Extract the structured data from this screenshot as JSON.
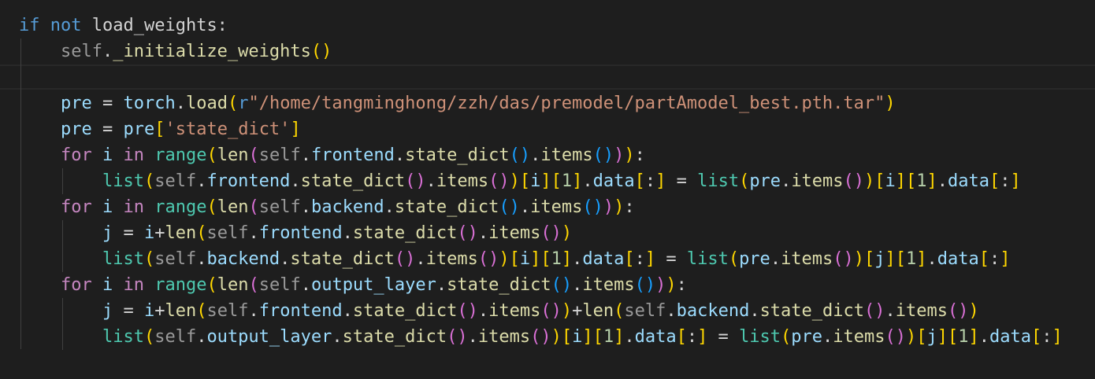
{
  "code": {
    "lines": [
      {
        "segments": [
          {
            "t": "if",
            "c": "kw"
          },
          {
            "t": " "
          },
          {
            "t": "not",
            "c": "kw"
          },
          {
            "t": " load_weights:"
          }
        ]
      },
      {
        "segments": [
          {
            "t": "    "
          },
          {
            "t": "self",
            "c": "slf"
          },
          {
            "t": "."
          },
          {
            "t": "_initialize_weights",
            "c": "fn"
          },
          {
            "t": "()",
            "c": "b1"
          }
        ]
      },
      {
        "segments": []
      },
      {
        "segments": [
          {
            "t": "    "
          },
          {
            "t": "pre",
            "c": "var"
          },
          {
            "t": " = "
          },
          {
            "t": "torch",
            "c": "var"
          },
          {
            "t": "."
          },
          {
            "t": "load",
            "c": "fn"
          },
          {
            "t": "(",
            "c": "b1"
          },
          {
            "t": "r",
            "c": "kw"
          },
          {
            "t": "\"/home/tangminghong/zzh/das/premodel/partAmodel_best.pth.tar\"",
            "c": "str"
          },
          {
            "t": ")",
            "c": "b1"
          }
        ]
      },
      {
        "segments": [
          {
            "t": "    "
          },
          {
            "t": "pre",
            "c": "var"
          },
          {
            "t": " = "
          },
          {
            "t": "pre",
            "c": "var"
          },
          {
            "t": "[",
            "c": "b1"
          },
          {
            "t": "'state_dict'",
            "c": "str"
          },
          {
            "t": "]",
            "c": "b1"
          }
        ]
      },
      {
        "segments": [
          {
            "t": "    "
          },
          {
            "t": "for",
            "c": "kc"
          },
          {
            "t": " "
          },
          {
            "t": "i",
            "c": "var"
          },
          {
            "t": " "
          },
          {
            "t": "in",
            "c": "kc"
          },
          {
            "t": " "
          },
          {
            "t": "range",
            "c": "fnb"
          },
          {
            "t": "(",
            "c": "b1"
          },
          {
            "t": "len",
            "c": "fn"
          },
          {
            "t": "(",
            "c": "b2"
          },
          {
            "t": "self",
            "c": "slf"
          },
          {
            "t": "."
          },
          {
            "t": "frontend",
            "c": "var"
          },
          {
            "t": "."
          },
          {
            "t": "state_dict",
            "c": "fn"
          },
          {
            "t": "()",
            "c": "b3"
          },
          {
            "t": "."
          },
          {
            "t": "items",
            "c": "fn"
          },
          {
            "t": "()",
            "c": "b3"
          },
          {
            "t": ")",
            "c": "b2"
          },
          {
            "t": ")",
            "c": "b1"
          },
          {
            "t": ":"
          }
        ]
      },
      {
        "segments": [
          {
            "t": "        "
          },
          {
            "t": "list",
            "c": "fnb"
          },
          {
            "t": "(",
            "c": "b1"
          },
          {
            "t": "self",
            "c": "slf"
          },
          {
            "t": "."
          },
          {
            "t": "frontend",
            "c": "var"
          },
          {
            "t": "."
          },
          {
            "t": "state_dict",
            "c": "fn"
          },
          {
            "t": "()",
            "c": "b2"
          },
          {
            "t": "."
          },
          {
            "t": "items",
            "c": "fn"
          },
          {
            "t": "()",
            "c": "b2"
          },
          {
            "t": ")",
            "c": "b1"
          },
          {
            "t": "[",
            "c": "b1"
          },
          {
            "t": "i",
            "c": "var"
          },
          {
            "t": "]",
            "c": "b1"
          },
          {
            "t": "[",
            "c": "b1"
          },
          {
            "t": "1",
            "c": "num"
          },
          {
            "t": "]",
            "c": "b1"
          },
          {
            "t": "."
          },
          {
            "t": "data",
            "c": "var"
          },
          {
            "t": "[",
            "c": "b1"
          },
          {
            "t": ":"
          },
          {
            "t": "]",
            "c": "b1"
          },
          {
            "t": " = "
          },
          {
            "t": "list",
            "c": "fnb"
          },
          {
            "t": "(",
            "c": "b1"
          },
          {
            "t": "pre",
            "c": "var"
          },
          {
            "t": "."
          },
          {
            "t": "items",
            "c": "fn"
          },
          {
            "t": "()",
            "c": "b2"
          },
          {
            "t": ")",
            "c": "b1"
          },
          {
            "t": "[",
            "c": "b1"
          },
          {
            "t": "i",
            "c": "var"
          },
          {
            "t": "]",
            "c": "b1"
          },
          {
            "t": "[",
            "c": "b1"
          },
          {
            "t": "1",
            "c": "num"
          },
          {
            "t": "]",
            "c": "b1"
          },
          {
            "t": "."
          },
          {
            "t": "data",
            "c": "var"
          },
          {
            "t": "[",
            "c": "b1"
          },
          {
            "t": ":"
          },
          {
            "t": "]",
            "c": "b1"
          }
        ]
      },
      {
        "segments": [
          {
            "t": "    "
          },
          {
            "t": "for",
            "c": "kc"
          },
          {
            "t": " "
          },
          {
            "t": "i",
            "c": "var"
          },
          {
            "t": " "
          },
          {
            "t": "in",
            "c": "kc"
          },
          {
            "t": " "
          },
          {
            "t": "range",
            "c": "fnb"
          },
          {
            "t": "(",
            "c": "b1"
          },
          {
            "t": "len",
            "c": "fn"
          },
          {
            "t": "(",
            "c": "b2"
          },
          {
            "t": "self",
            "c": "slf"
          },
          {
            "t": "."
          },
          {
            "t": "backend",
            "c": "var"
          },
          {
            "t": "."
          },
          {
            "t": "state_dict",
            "c": "fn"
          },
          {
            "t": "()",
            "c": "b3"
          },
          {
            "t": "."
          },
          {
            "t": "items",
            "c": "fn"
          },
          {
            "t": "()",
            "c": "b3"
          },
          {
            "t": ")",
            "c": "b2"
          },
          {
            "t": ")",
            "c": "b1"
          },
          {
            "t": ":"
          }
        ]
      },
      {
        "segments": [
          {
            "t": "        "
          },
          {
            "t": "j",
            "c": "var"
          },
          {
            "t": " = "
          },
          {
            "t": "i",
            "c": "var"
          },
          {
            "t": "+"
          },
          {
            "t": "len",
            "c": "fn"
          },
          {
            "t": "(",
            "c": "b1"
          },
          {
            "t": "self",
            "c": "slf"
          },
          {
            "t": "."
          },
          {
            "t": "frontend",
            "c": "var"
          },
          {
            "t": "."
          },
          {
            "t": "state_dict",
            "c": "fn"
          },
          {
            "t": "()",
            "c": "b2"
          },
          {
            "t": "."
          },
          {
            "t": "items",
            "c": "fn"
          },
          {
            "t": "()",
            "c": "b2"
          },
          {
            "t": ")",
            "c": "b1"
          }
        ]
      },
      {
        "segments": [
          {
            "t": "        "
          },
          {
            "t": "list",
            "c": "fnb"
          },
          {
            "t": "(",
            "c": "b1"
          },
          {
            "t": "self",
            "c": "slf"
          },
          {
            "t": "."
          },
          {
            "t": "backend",
            "c": "var"
          },
          {
            "t": "."
          },
          {
            "t": "state_dict",
            "c": "fn"
          },
          {
            "t": "()",
            "c": "b2"
          },
          {
            "t": "."
          },
          {
            "t": "items",
            "c": "fn"
          },
          {
            "t": "()",
            "c": "b2"
          },
          {
            "t": ")",
            "c": "b1"
          },
          {
            "t": "[",
            "c": "b1"
          },
          {
            "t": "i",
            "c": "var"
          },
          {
            "t": "]",
            "c": "b1"
          },
          {
            "t": "[",
            "c": "b1"
          },
          {
            "t": "1",
            "c": "num"
          },
          {
            "t": "]",
            "c": "b1"
          },
          {
            "t": "."
          },
          {
            "t": "data",
            "c": "var"
          },
          {
            "t": "[",
            "c": "b1"
          },
          {
            "t": ":"
          },
          {
            "t": "]",
            "c": "b1"
          },
          {
            "t": " = "
          },
          {
            "t": "list",
            "c": "fnb"
          },
          {
            "t": "(",
            "c": "b1"
          },
          {
            "t": "pre",
            "c": "var"
          },
          {
            "t": "."
          },
          {
            "t": "items",
            "c": "fn"
          },
          {
            "t": "()",
            "c": "b2"
          },
          {
            "t": ")",
            "c": "b1"
          },
          {
            "t": "[",
            "c": "b1"
          },
          {
            "t": "j",
            "c": "var"
          },
          {
            "t": "]",
            "c": "b1"
          },
          {
            "t": "[",
            "c": "b1"
          },
          {
            "t": "1",
            "c": "num"
          },
          {
            "t": "]",
            "c": "b1"
          },
          {
            "t": "."
          },
          {
            "t": "data",
            "c": "var"
          },
          {
            "t": "[",
            "c": "b1"
          },
          {
            "t": ":"
          },
          {
            "t": "]",
            "c": "b1"
          }
        ]
      },
      {
        "segments": [
          {
            "t": "    "
          },
          {
            "t": "for",
            "c": "kc"
          },
          {
            "t": " "
          },
          {
            "t": "i",
            "c": "var"
          },
          {
            "t": " "
          },
          {
            "t": "in",
            "c": "kc"
          },
          {
            "t": " "
          },
          {
            "t": "range",
            "c": "fnb"
          },
          {
            "t": "(",
            "c": "b1"
          },
          {
            "t": "len",
            "c": "fn"
          },
          {
            "t": "(",
            "c": "b2"
          },
          {
            "t": "self",
            "c": "slf"
          },
          {
            "t": "."
          },
          {
            "t": "output_layer",
            "c": "var"
          },
          {
            "t": "."
          },
          {
            "t": "state_dict",
            "c": "fn"
          },
          {
            "t": "()",
            "c": "b3"
          },
          {
            "t": "."
          },
          {
            "t": "items",
            "c": "fn"
          },
          {
            "t": "()",
            "c": "b3"
          },
          {
            "t": ")",
            "c": "b2"
          },
          {
            "t": ")",
            "c": "b1"
          },
          {
            "t": ":"
          }
        ]
      },
      {
        "segments": [
          {
            "t": "        "
          },
          {
            "t": "j",
            "c": "var"
          },
          {
            "t": " = "
          },
          {
            "t": "i",
            "c": "var"
          },
          {
            "t": "+"
          },
          {
            "t": "len",
            "c": "fn"
          },
          {
            "t": "(",
            "c": "b1"
          },
          {
            "t": "self",
            "c": "slf"
          },
          {
            "t": "."
          },
          {
            "t": "frontend",
            "c": "var"
          },
          {
            "t": "."
          },
          {
            "t": "state_dict",
            "c": "fn"
          },
          {
            "t": "()",
            "c": "b2"
          },
          {
            "t": "."
          },
          {
            "t": "items",
            "c": "fn"
          },
          {
            "t": "()",
            "c": "b2"
          },
          {
            "t": ")",
            "c": "b1"
          },
          {
            "t": "+"
          },
          {
            "t": "len",
            "c": "fn"
          },
          {
            "t": "(",
            "c": "b1"
          },
          {
            "t": "self",
            "c": "slf"
          },
          {
            "t": "."
          },
          {
            "t": "backend",
            "c": "var"
          },
          {
            "t": "."
          },
          {
            "t": "state_dict",
            "c": "fn"
          },
          {
            "t": "()",
            "c": "b2"
          },
          {
            "t": "."
          },
          {
            "t": "items",
            "c": "fn"
          },
          {
            "t": "()",
            "c": "b2"
          },
          {
            "t": ")",
            "c": "b1"
          }
        ]
      },
      {
        "segments": [
          {
            "t": "        "
          },
          {
            "t": "list",
            "c": "fnb"
          },
          {
            "t": "(",
            "c": "b1"
          },
          {
            "t": "self",
            "c": "slf"
          },
          {
            "t": "."
          },
          {
            "t": "output_layer",
            "c": "var"
          },
          {
            "t": "."
          },
          {
            "t": "state_dict",
            "c": "fn"
          },
          {
            "t": "()",
            "c": "b2"
          },
          {
            "t": "."
          },
          {
            "t": "items",
            "c": "fn"
          },
          {
            "t": "()",
            "c": "b2"
          },
          {
            "t": ")",
            "c": "b1"
          },
          {
            "t": "[",
            "c": "b1"
          },
          {
            "t": "i",
            "c": "var"
          },
          {
            "t": "]",
            "c": "b1"
          },
          {
            "t": "[",
            "c": "b1"
          },
          {
            "t": "1",
            "c": "num"
          },
          {
            "t": "]",
            "c": "b1"
          },
          {
            "t": "."
          },
          {
            "t": "data",
            "c": "var"
          },
          {
            "t": "[",
            "c": "b1"
          },
          {
            "t": ":"
          },
          {
            "t": "]",
            "c": "b1"
          },
          {
            "t": " = "
          },
          {
            "t": "list",
            "c": "fnb"
          },
          {
            "t": "(",
            "c": "b1"
          },
          {
            "t": "pre",
            "c": "var"
          },
          {
            "t": "."
          },
          {
            "t": "items",
            "c": "fn"
          },
          {
            "t": "()",
            "c": "b2"
          },
          {
            "t": ")",
            "c": "b1"
          },
          {
            "t": "[",
            "c": "b1"
          },
          {
            "t": "j",
            "c": "var"
          },
          {
            "t": "]",
            "c": "b1"
          },
          {
            "t": "[",
            "c": "b1"
          },
          {
            "t": "1",
            "c": "num"
          },
          {
            "t": "]",
            "c": "b1"
          },
          {
            "t": "."
          },
          {
            "t": "data",
            "c": "var"
          },
          {
            "t": "[",
            "c": "b1"
          },
          {
            "t": ":"
          },
          {
            "t": "]",
            "c": "b1"
          }
        ]
      }
    ]
  },
  "colors": {
    "background": "#1e1e1e",
    "keyword": "#569cd6",
    "control": "#c586c0",
    "function": "#dcdcaa",
    "variable": "#9cdcfe",
    "string": "#ce9178",
    "number": "#b5cea8",
    "bracket_1": "#ffd700",
    "bracket_2": "#da70d6",
    "bracket_3": "#179fff"
  }
}
